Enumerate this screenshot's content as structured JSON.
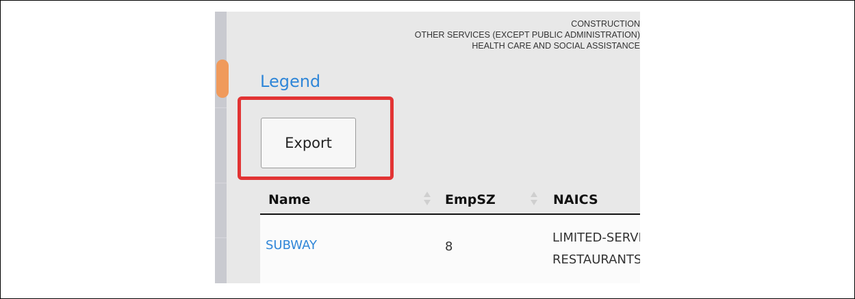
{
  "chart_labels": [
    "CONSTRUCTION",
    "OTHER SERVICES (EXCEPT PUBLIC ADMINISTRATION)",
    "HEALTH CARE AND SOCIAL ASSISTANCE"
  ],
  "legend": {
    "label": "Legend"
  },
  "export": {
    "label": "Export"
  },
  "table": {
    "headers": [
      "Name",
      "EmpSZ",
      "NAICS"
    ],
    "rows": [
      {
        "name": "SUBWAY",
        "empsz": "8",
        "naics_line1": "LIMITED-SERVICE",
        "naics_line2": "RESTAURANTS"
      }
    ]
  },
  "colors": {
    "link": "#2f86d8",
    "highlight": "#e23434",
    "panel": "#e8e8e8"
  }
}
